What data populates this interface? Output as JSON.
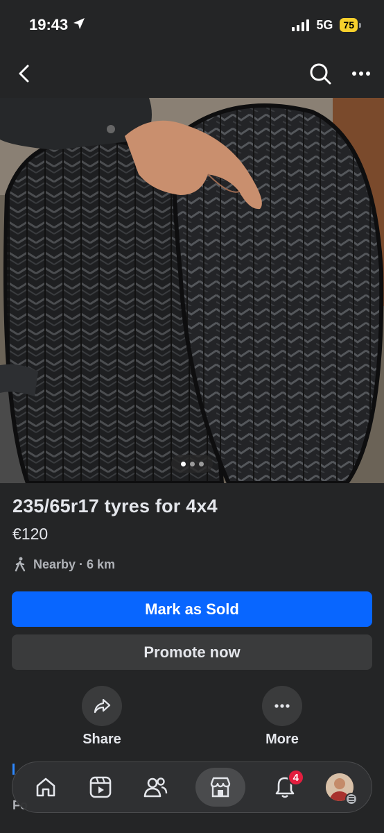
{
  "status_bar": {
    "time": "19:43",
    "network": "5G",
    "battery": "75",
    "battery_color": "#f7d02c"
  },
  "nav": {
    "back_icon": "chevron-left-icon",
    "search_icon": "search-icon",
    "more_icon": "more-horizontal-icon"
  },
  "photo": {
    "carousel_count": 3,
    "carousel_active": 0
  },
  "listing": {
    "title": "235/65r17 tyres for 4x4",
    "price": "€120",
    "location": "Nearby · 6 km"
  },
  "buttons": {
    "mark_sold": "Mark as Sold",
    "promote": "Promote now",
    "primary_color": "#0866ff"
  },
  "actions": {
    "share_label": "Share",
    "more_label": "More"
  },
  "tab_bar": {
    "tabs": [
      {
        "name": "home",
        "icon": "home-icon"
      },
      {
        "name": "video",
        "icon": "video-icon"
      },
      {
        "name": "friends",
        "icon": "friends-icon"
      },
      {
        "name": "marketplace",
        "icon": "marketplace-icon",
        "active": true
      },
      {
        "name": "notifications",
        "icon": "bell-icon"
      },
      {
        "name": "profile",
        "icon": "avatar"
      }
    ],
    "notification_count": "4"
  },
  "peek_text": "Fo"
}
